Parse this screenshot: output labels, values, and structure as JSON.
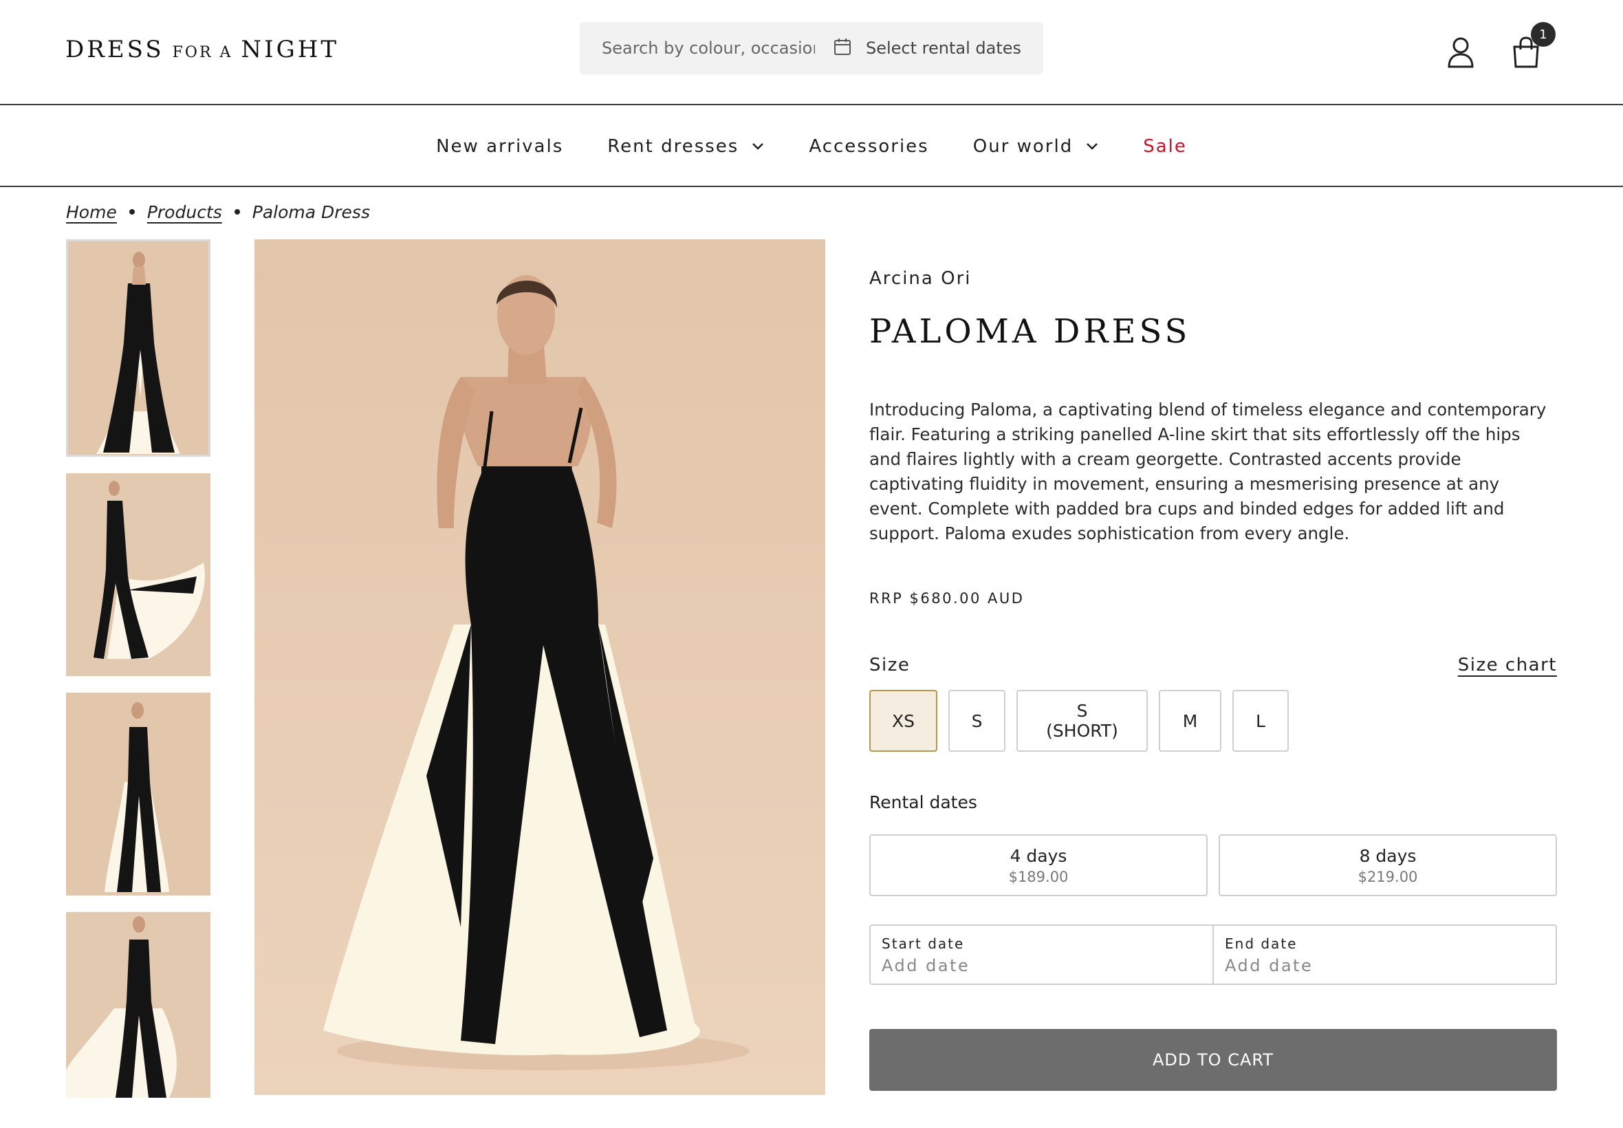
{
  "header": {
    "logo": {
      "part1": "DRESS",
      "part2": "FOR A",
      "part3": "NIGHT"
    },
    "search": {
      "placeholder": "Search by colour, occasion",
      "date_label": "Select rental dates"
    },
    "cart_count": "1",
    "icons": [
      "calendar-icon",
      "account-icon",
      "cart-icon"
    ]
  },
  "nav": {
    "items": [
      {
        "label": "New arrivals",
        "has_dropdown": false
      },
      {
        "label": "Rent dresses",
        "has_dropdown": true
      },
      {
        "label": "Accessories",
        "has_dropdown": false
      },
      {
        "label": "Our world",
        "has_dropdown": true
      },
      {
        "label": "Sale",
        "has_dropdown": false,
        "color": "#c8102e"
      }
    ]
  },
  "breadcrumb": {
    "home": "Home",
    "products": "Products",
    "current": "Paloma Dress"
  },
  "gallery": {
    "thumbnail_count": 4,
    "active_thumbnail": 1
  },
  "product": {
    "brand": "Arcina Ori",
    "title": "PALOMA DRESS",
    "description": "Introducing Paloma, a captivating blend of timeless elegance and contemporary flair. Featuring a striking panelled A-line skirt that sits effortlessly off the hips and flaires lightly with a cream georgette. Contrasted accents provide captivating fluidity in movement, ensuring a mesmerising presence at any event. Complete with padded bra cups and binded edges for added lift and support. Paloma exudes sophistication from every angle.",
    "rrp": "RRP $680.00 AUD"
  },
  "size": {
    "label": "Size",
    "chart_link": "Size chart",
    "options": [
      "XS",
      "S",
      "S (SHORT)",
      "M",
      "L"
    ],
    "selected": "XS"
  },
  "rental": {
    "label": "Rental dates",
    "options": [
      {
        "days": "4 days",
        "price": "$189.00"
      },
      {
        "days": "8 days",
        "price": "$219.00"
      }
    ],
    "start_label": "Start date",
    "start_value": "Add date",
    "end_label": "End date",
    "end_value": "Add date"
  },
  "cta": {
    "add_to_cart": "ADD TO CART"
  },
  "colors": {
    "sale": "#c8102e",
    "selected_size_bg": "#f5ede0",
    "selected_size_border": "#b8964a",
    "cta_bg": "#6d6d6d",
    "photo_bg": "#e2c7ad"
  }
}
